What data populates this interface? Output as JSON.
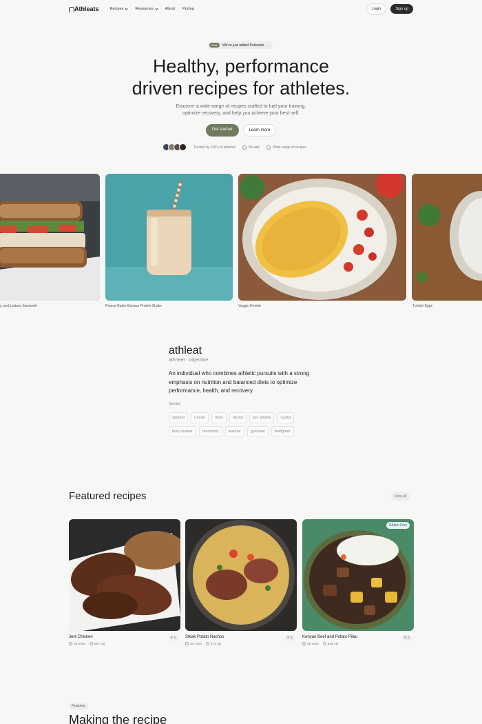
{
  "nav": {
    "brand": "Athleats",
    "links": [
      {
        "label": "Recipes",
        "dropdown": true
      },
      {
        "label": "Resources",
        "dropdown": true
      },
      {
        "label": "About",
        "dropdown": false
      },
      {
        "label": "Pricing",
        "dropdown": false
      }
    ],
    "login": "Login",
    "signup": "Sign up"
  },
  "hero": {
    "badge_tag": "New",
    "badge_text": "We've just added Podcasts",
    "title_line1": "Healthy, performance",
    "title_line2": "driven recipes for athletes.",
    "subtitle_line1": "Discover a wide-range of recipes crafted to fuel your training,",
    "subtitle_line2": "optimize recovery, and help you achieve your best self.",
    "cta_primary": "Get started",
    "cta_secondary": "Learn more",
    "trust_text": "Trusted by 100's of athletes",
    "feature1": "No ads",
    "feature2": "Wide-range of recipes"
  },
  "carousel": [
    {
      "caption": "y, and Lettuce Sandwich"
    },
    {
      "caption": "Peanut Butter Banana Protein Shake"
    },
    {
      "caption": "Veggie Omelet"
    },
    {
      "caption": "Turkish Eggs"
    }
  ],
  "definition": {
    "word": "athleat",
    "pronunciation": "ath-leet · adjective",
    "meaning": "An individual who combines athletic pursuits with a strong emphasis on nutrition and balanced diets to optimize performance, health, and recovery.",
    "similar_label": "Similar:",
    "similar": [
      "student",
      "runner",
      "mom",
      "doctor",
      "pro athlete",
      "cyclist",
      "body builder",
      "mechanic",
      "teacher",
      "gymnast",
      "firefighter"
    ]
  },
  "featured": {
    "title": "Featured recipes",
    "view_all": "View all",
    "recipes": [
      {
        "name": "Jerk Chicken",
        "time": "55 mins",
        "cal": "587 cal",
        "likes": "6"
      },
      {
        "name": "Steak Potato Nachos",
        "time": "33 mins",
        "cal": "574 cal",
        "likes": "4"
      },
      {
        "name": "Kenyan Beef and Potato Pilau",
        "time": "45 mins",
        "cal": "525 cal",
        "likes": "5",
        "badge": "Gluten Free"
      }
    ]
  },
  "features_section": {
    "badge": "Features",
    "heading": "Making the recipe"
  },
  "colors": {
    "accent": "#6f7a5f",
    "dark": "#2b2b2b",
    "background": "#f7f7f6"
  }
}
